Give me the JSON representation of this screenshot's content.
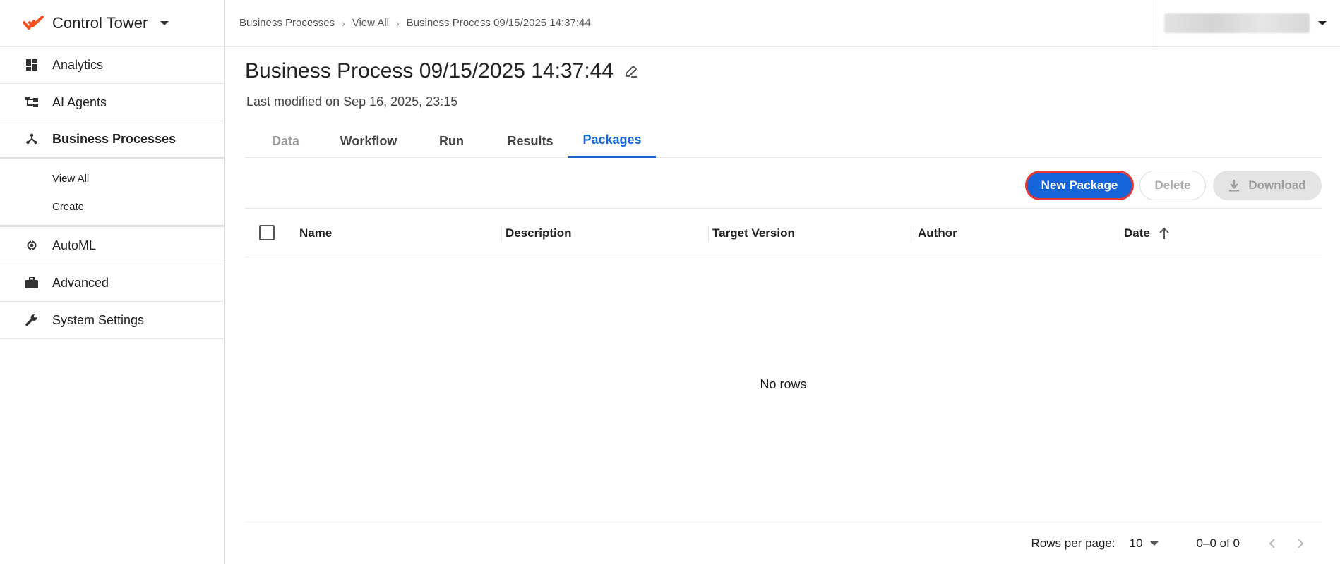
{
  "app": {
    "title": "Control Tower"
  },
  "sidebar": {
    "items": [
      {
        "label": "Analytics",
        "icon": "dashboard-icon"
      },
      {
        "label": "AI Agents",
        "icon": "hierarchy-icon"
      },
      {
        "label": "Business Processes",
        "icon": "branch-icon",
        "active": true,
        "children": [
          {
            "label": "View All"
          },
          {
            "label": "Create"
          }
        ]
      },
      {
        "label": "AutoML",
        "icon": "automl-icon"
      },
      {
        "label": "Advanced",
        "icon": "briefcase-icon"
      },
      {
        "label": "System Settings",
        "icon": "wrench-icon"
      }
    ]
  },
  "breadcrumb": [
    "Business Processes",
    "View All",
    "Business Process 09/15/2025 14:37:44"
  ],
  "page": {
    "title": "Business Process 09/15/2025 14:37:44",
    "last_modified": "Last modified on Sep 16, 2025, 23:15"
  },
  "tabs": [
    {
      "label": "Data",
      "state": "disabled"
    },
    {
      "label": "Workflow"
    },
    {
      "label": "Run"
    },
    {
      "label": "Results"
    },
    {
      "label": "Packages",
      "state": "active"
    }
  ],
  "actions": {
    "new_package": "New Package",
    "delete": "Delete",
    "download": "Download"
  },
  "table": {
    "columns": [
      "Name",
      "Description",
      "Target Version",
      "Author",
      "Date"
    ],
    "sort": {
      "column": "Date",
      "direction": "ascending"
    },
    "empty_text": "No rows"
  },
  "pagination": {
    "rows_per_page_label": "Rows per page:",
    "rows_per_page": "10",
    "range": "0–0 of 0"
  },
  "colors": {
    "accent": "#1565d8",
    "highlight_border": "#e53935",
    "brand": "#f4511e"
  }
}
